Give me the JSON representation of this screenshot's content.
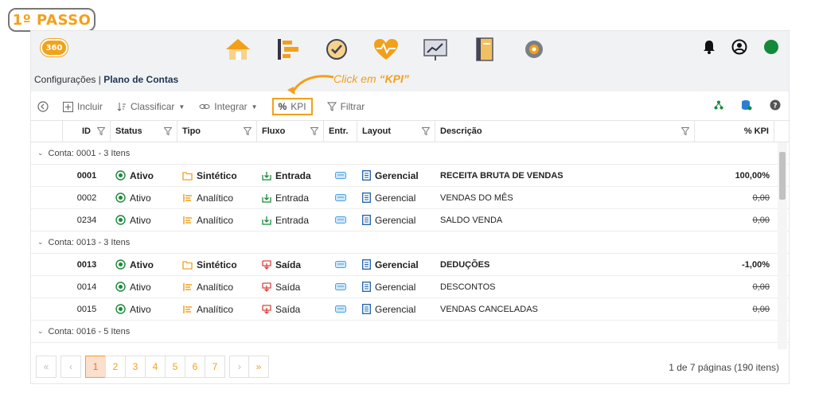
{
  "step_badge": "1º PASSO",
  "header": {
    "logo_text": "360"
  },
  "breadcrumb": {
    "section": "Configurações",
    "separator": "|",
    "page": "Plano de Contas"
  },
  "annotation": {
    "prefix": "Click em ",
    "highlight": "“KPI”"
  },
  "toolbar": {
    "incluir": "Incluir",
    "classificar": "Classificar",
    "integrar": "Integrar",
    "kpi": "KPI",
    "filtrar": "Filtrar"
  },
  "columns": [
    "ID",
    "Status",
    "Tipo",
    "Fluxo",
    "Entr.",
    "Layout",
    "Descrição",
    "% KPI"
  ],
  "groups": [
    {
      "label": "Conta: 0001 - 3 Itens",
      "rows": [
        {
          "bold": true,
          "id": "0001",
          "status": "Ativo",
          "tipo": "Sintético",
          "fluxo": "Entrada",
          "layout": "Gerencial",
          "descricao": "RECEITA BRUTA DE VENDAS",
          "kpi": "100,00%",
          "kpi_strike": false
        },
        {
          "bold": false,
          "id": "0002",
          "status": "Ativo",
          "tipo": "Analítico",
          "fluxo": "Entrada",
          "layout": "Gerencial",
          "descricao": "VENDAS DO MÊS",
          "kpi": "0,00",
          "kpi_strike": true
        },
        {
          "bold": false,
          "id": "0234",
          "status": "Ativo",
          "tipo": "Analítico",
          "fluxo": "Entrada",
          "layout": "Gerencial",
          "descricao": "SALDO VENDA",
          "kpi": "0,00",
          "kpi_strike": true
        }
      ]
    },
    {
      "label": "Conta: 0013 - 3 Itens",
      "rows": [
        {
          "bold": true,
          "id": "0013",
          "status": "Ativo",
          "tipo": "Sintético",
          "fluxo": "Saída",
          "layout": "Gerencial",
          "descricao": "DEDUÇÕES",
          "kpi": "-1,00%",
          "kpi_strike": false
        },
        {
          "bold": false,
          "id": "0014",
          "status": "Ativo",
          "tipo": "Analítico",
          "fluxo": "Saída",
          "layout": "Gerencial",
          "descricao": "DESCONTOS",
          "kpi": "0,00",
          "kpi_strike": true
        },
        {
          "bold": false,
          "id": "0015",
          "status": "Ativo",
          "tipo": "Analítico",
          "fluxo": "Saída",
          "layout": "Gerencial",
          "descricao": "VENDAS CANCELADAS",
          "kpi": "0,00",
          "kpi_strike": true
        }
      ]
    },
    {
      "label": "Conta: 0016 - 5 Itens",
      "rows": []
    }
  ],
  "pager": {
    "first": "«",
    "prev": "‹",
    "pages": [
      "1",
      "2",
      "3",
      "4",
      "5",
      "6",
      "7"
    ],
    "active": "1",
    "next": "›",
    "last": "»",
    "info": "1 de 7 páginas (190 itens)"
  },
  "colors": {
    "accent": "#f2a01a",
    "status_ok": "#1a8a3a",
    "saida": "#e04040",
    "entrada": "#1a8a3a",
    "layout": "#1d5fa8"
  }
}
